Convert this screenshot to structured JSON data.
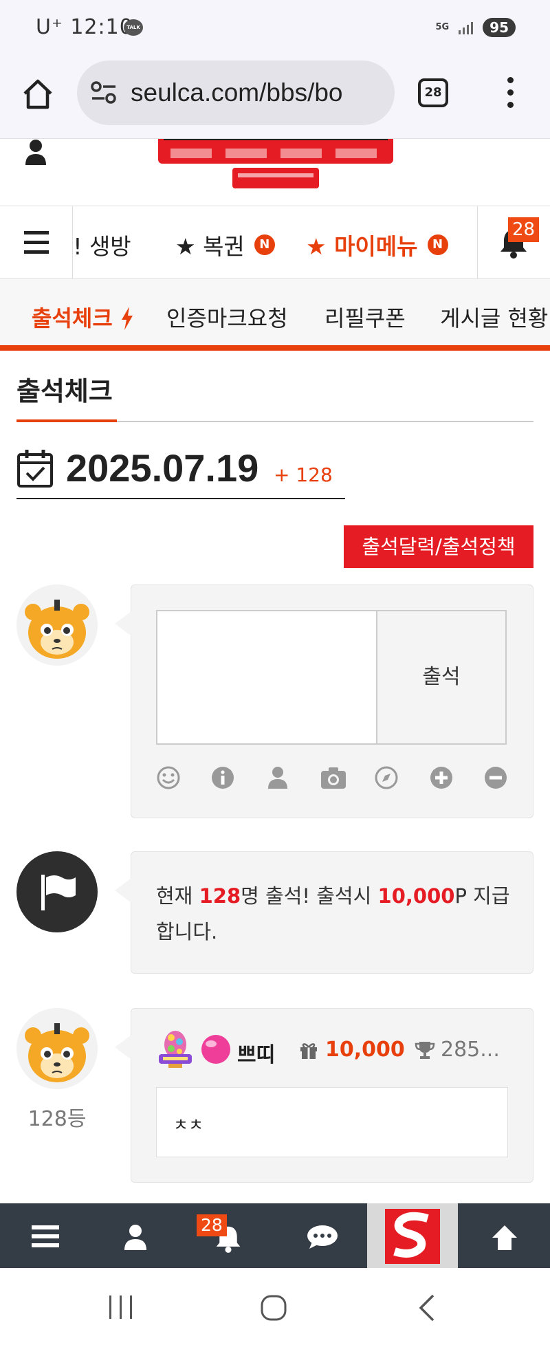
{
  "status_bar": {
    "time": "U⁺ 12:10",
    "talk_badge": "TALK",
    "network": "5G",
    "battery": "95"
  },
  "browser": {
    "url": "seulca.com/bbs/bo",
    "tab_count": "28"
  },
  "nav": {
    "items": [
      {
        "label": "!! 생방",
        "style": "normal"
      },
      {
        "label": "★ 복권",
        "style": "normal",
        "badge": "N"
      },
      {
        "label": "★ 마이메뉴",
        "style": "red",
        "badge": "N"
      }
    ],
    "notification_count": "28"
  },
  "submenu": {
    "items": [
      "출석체크",
      "인증마크요청",
      "리필쿠폰",
      "게시글 현황"
    ]
  },
  "page": {
    "title": "출석체크",
    "date": "2025.07.19",
    "date_plus": "+ 128",
    "policy_button": "출석달력/출석정책"
  },
  "attend_form": {
    "submit_label": "출석"
  },
  "notice": {
    "prefix": "현재 ",
    "count": "128",
    "mid": "명 출석! 출석시 ",
    "points": "10,000",
    "suffix": "P 지급합니다."
  },
  "entry": {
    "rank": "128등",
    "nickname": "쁘띠",
    "points": "10,000",
    "trophy": "285...",
    "comment": "ㅊㅊ"
  },
  "bottom_nav": {
    "notification_count": "28"
  },
  "colors": {
    "accent": "#e8400c",
    "red_button": "#e51c23",
    "bottom_nav": "#343c45"
  }
}
